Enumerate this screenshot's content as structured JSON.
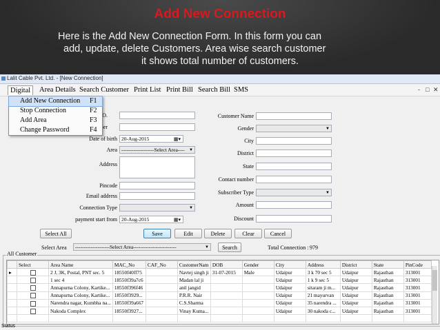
{
  "slide": {
    "title": "Add New Connection",
    "line1": "Here is the Add New Connection Form. In this form you can",
    "line2": "add, update, delete Customers. Area wise search customer",
    "line3": "it shows total number of customers."
  },
  "window": {
    "title": "Lalit Cable Pvt. Ltd. - [New Connection]",
    "controls": [
      "_",
      "□",
      "✕"
    ],
    "mdi_controls": [
      "-",
      "□",
      "✕"
    ]
  },
  "menu": [
    "Digital",
    "Area Details",
    "Search Customer",
    "Print List",
    "Print Bill",
    "Search Bill",
    "SMS"
  ],
  "dropdown": [
    {
      "label": "Add New Connection",
      "key": "F1"
    },
    {
      "label": "Stop Connection",
      "key": "F2"
    },
    {
      "label": "Add Area",
      "key": "F3"
    },
    {
      "label": "Change Password",
      "key": "F4"
    }
  ],
  "form": {
    "left_labels": {
      "id_no": "d NO.",
      "number": "mber",
      "dob": "Date of birth",
      "area": "Area",
      "address": "Address",
      "pincode": "Pincode",
      "email": "Email address",
      "conn_type": "Connection Type",
      "payment_start": "payment start from"
    },
    "dob_value": "20-Aug-2015",
    "area_value": "-------------------Select Area----",
    "payment_value": "20-Aug-2015",
    "right_labels": {
      "cust_name": "Customer Name",
      "gender": "Gender",
      "city": "City",
      "district": "District",
      "state": "State",
      "contact": "Contact number",
      "sub_type": "Subscriber Type",
      "amount": "Amount",
      "discount": "Discount"
    },
    "buttons": {
      "select_all": "Select All",
      "save": "Save",
      "edit": "Edit",
      "delete": "Delete",
      "clear": "Clear",
      "cancel": "Cancel",
      "search": "Search"
    },
    "select_area_label": "Select Area",
    "select_area_value": "--------------------Select Area-------------------------",
    "total_label": "Total Connection :",
    "total_value": "979"
  },
  "grid": {
    "group_label": "All Customer",
    "columns": [
      "",
      "Select",
      "Area Name",
      "MAC_No",
      "CAF_No",
      "CustomerNam",
      "DOB",
      "Gender",
      "City",
      "Address",
      "District",
      "State",
      "PinCode"
    ],
    "rows": [
      [
        "▸",
        "",
        "2 J, 3K, Postal, PNT sec. 5",
        "18550f40ff75",
        "",
        "Navtej singh ji",
        "31-07-2015",
        "Male",
        "Udaipur",
        "3 k 70 sec 5",
        "Udaipur",
        "Rajasthan",
        "313001"
      ],
      [
        "",
        "",
        "1 sec 4",
        "18550f39a7c6",
        "",
        "Madan lal ji",
        "",
        "",
        "Udaipur",
        "1 k 9 sec 5",
        "Udaipur",
        "Rajasthan",
        "313001"
      ],
      [
        "",
        "",
        "Annapurna Colony, Kartike...",
        "18550f396f46",
        "",
        "anil jangid",
        "",
        "",
        "Udaipur",
        "sitaram ji m...",
        "Udaipur",
        "Rajasthan",
        "313001"
      ],
      [
        "",
        "",
        "Annapurna Colony, Kartike...",
        "18550f3929...",
        "",
        "P.R.R. Nair",
        "",
        "",
        "Udaipur",
        "21 mayurvan",
        "Udaipur",
        "Rajasthan",
        "313001"
      ],
      [
        "",
        "",
        "Narendra nagar, Kumbha na...",
        "18550f39a667",
        "",
        "C.S.Sharma",
        "",
        "",
        "Udaipur",
        "35 narendra ...",
        "Udaipur",
        "Rajasthan",
        "313001"
      ],
      [
        "",
        "",
        "Nakoda Complex",
        "18550f3927...",
        "",
        "Vinay Kuma...",
        "",
        "",
        "Udaipur",
        "30 nakoda c...",
        "Udaipur",
        "Rajasthan",
        "313001"
      ],
      [
        "",
        "",
        "",
        "",
        "",
        "",
        "",
        "",
        "",
        "",
        "",
        "",
        ""
      ]
    ]
  },
  "status": "Status"
}
